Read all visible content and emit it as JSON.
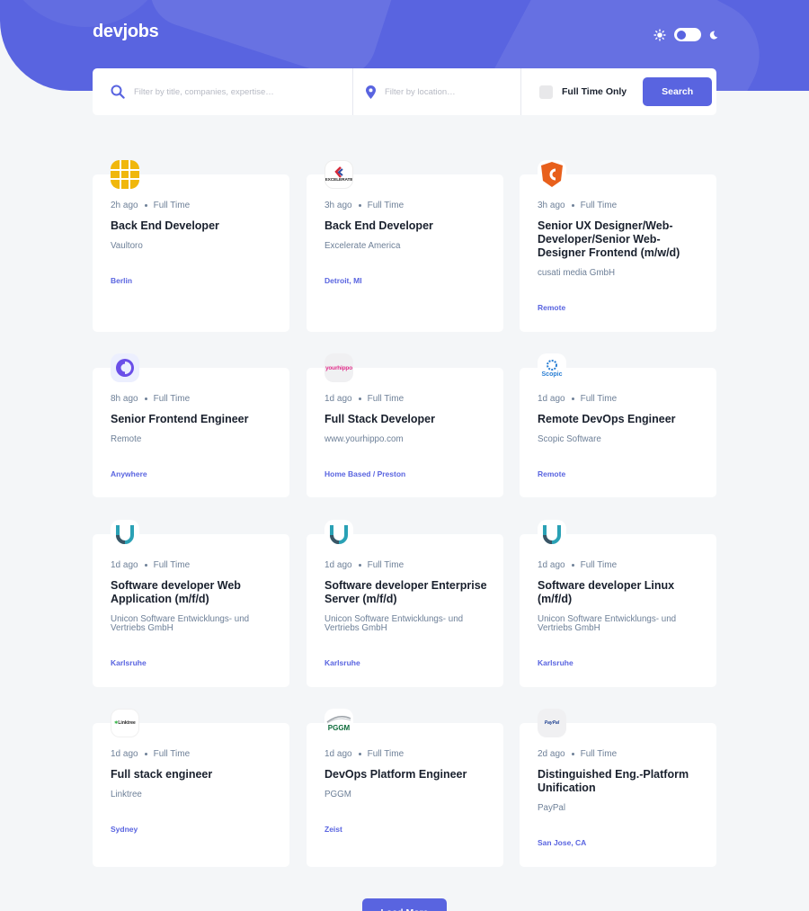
{
  "header": {
    "logo": "devjobs",
    "brand_color": "#5964e0",
    "theme_toggle": {
      "left_icon": "sun-icon",
      "right_icon": "moon-icon",
      "state": "light"
    }
  },
  "filter": {
    "title_placeholder": "Filter by title, companies, expertise…",
    "location_placeholder": "Filter by location…",
    "full_time_label": "Full Time Only",
    "full_time_checked": false,
    "search_label": "Search"
  },
  "jobs": [
    {
      "posted": "2h ago",
      "contract": "Full Time",
      "title": "Back End Developer",
      "company": "Vaultoro",
      "location": "Berlin",
      "logo_icon": "vaultoro-logo-icon"
    },
    {
      "posted": "3h ago",
      "contract": "Full Time",
      "title": "Back End Developer",
      "company": "Excelerate America",
      "location": "Detroit, MI",
      "logo_icon": "excelerate-logo-icon",
      "logo_text": "EXCELERATE"
    },
    {
      "posted": "3h ago",
      "contract": "Full Time",
      "title": "Senior UX Designer/Web-Developer/Senior Web-Designer Frontend (m/w/d)",
      "company": "cusati media GmbH",
      "location": "Remote",
      "logo_icon": "cusati-logo-icon"
    },
    {
      "posted": "8h ago",
      "contract": "Full Time",
      "title": "Senior Frontend Engineer",
      "company": "Remote",
      "location": "Anywhere",
      "logo_icon": "remote-logo-icon"
    },
    {
      "posted": "1d ago",
      "contract": "Full Time",
      "title": "Full Stack Developer",
      "company": "www.yourhippo.com",
      "location": "Home Based / Preston",
      "logo_icon": "yourhippo-logo-icon",
      "logo_text": "yourhippo"
    },
    {
      "posted": "1d ago",
      "contract": "Full Time",
      "title": "Remote DevOps Engineer",
      "company": "Scopic Software",
      "location": "Remote",
      "logo_icon": "scopic-logo-icon",
      "logo_text": "Scopic"
    },
    {
      "posted": "1d ago",
      "contract": "Full Time",
      "title": "Software developer Web Application (m/f/d)",
      "company": "Unicon Software Entwicklungs- und Vertriebs GmbH",
      "location": "Karlsruhe",
      "logo_icon": "unicon-logo-icon"
    },
    {
      "posted": "1d ago",
      "contract": "Full Time",
      "title": "Software developer Enterprise Server (m/f/d)",
      "company": "Unicon Software Entwicklungs- und Vertriebs GmbH",
      "location": "Karlsruhe",
      "logo_icon": "unicon-logo-icon"
    },
    {
      "posted": "1d ago",
      "contract": "Full Time",
      "title": "Software developer Linux (m/f/d)",
      "company": "Unicon Software Entwicklungs- und Vertriebs GmbH",
      "location": "Karlsruhe",
      "logo_icon": "unicon-logo-icon"
    },
    {
      "posted": "1d ago",
      "contract": "Full Time",
      "title": "Full stack engineer",
      "company": "Linktree",
      "location": "Sydney",
      "logo_icon": "linktree-logo-icon",
      "logo_text": "Linktree"
    },
    {
      "posted": "1d ago",
      "contract": "Full Time",
      "title": "DevOps Platform Engineer",
      "company": "PGGM",
      "location": "Zeist",
      "logo_icon": "pggm-logo-icon",
      "logo_text": "PGGM"
    },
    {
      "posted": "2d ago",
      "contract": "Full Time",
      "title": "Distinguished Eng.-Platform Unification",
      "company": "PayPal",
      "location": "San Jose, CA",
      "logo_icon": "paypal-logo-icon",
      "logo_text": "PayPal"
    }
  ],
  "load_more_label": "Load More"
}
